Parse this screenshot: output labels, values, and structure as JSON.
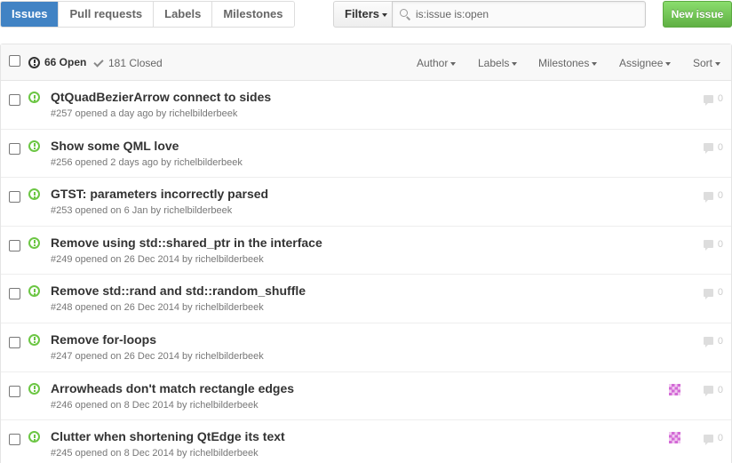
{
  "subnav": {
    "items": [
      {
        "label": "Issues",
        "selected": true
      },
      {
        "label": "Pull requests"
      },
      {
        "label": "Labels"
      },
      {
        "label": "Milestones"
      }
    ]
  },
  "filters": {
    "label": "Filters"
  },
  "search": {
    "value": "is:issue is:open"
  },
  "new_issue": {
    "label": "New issue"
  },
  "header": {
    "open_label": "66 Open",
    "closed_label": "181 Closed",
    "menus": [
      "Author",
      "Labels",
      "Milestones",
      "Assignee",
      "Sort"
    ]
  },
  "issues": [
    {
      "title": "QtQuadBezierArrow connect to sides",
      "meta": "#257 opened a day ago by",
      "author": "richelbilderbeek",
      "comments": "0",
      "has_avatar": false
    },
    {
      "title": "Show some QML love",
      "meta": "#256 opened 2 days ago by",
      "author": "richelbilderbeek",
      "comments": "0",
      "has_avatar": false
    },
    {
      "title": "GTST: parameters incorrectly parsed",
      "meta": "#253 opened on 6 Jan by",
      "author": "richelbilderbeek",
      "comments": "0",
      "has_avatar": false
    },
    {
      "title": "Remove using std::shared_ptr in the interface",
      "meta": "#249 opened on 26 Dec 2014 by",
      "author": "richelbilderbeek",
      "comments": "0",
      "has_avatar": false
    },
    {
      "title": "Remove std::rand and std::random_shuffle",
      "meta": "#248 opened on 26 Dec 2014 by",
      "author": "richelbilderbeek",
      "comments": "0",
      "has_avatar": false
    },
    {
      "title": "Remove for-loops",
      "meta": "#247 opened on 26 Dec 2014 by",
      "author": "richelbilderbeek",
      "comments": "0",
      "has_avatar": false
    },
    {
      "title": "Arrowheads don't match rectangle edges",
      "meta": "#246 opened on 8 Dec 2014 by",
      "author": "richelbilderbeek",
      "comments": "0",
      "has_avatar": true
    },
    {
      "title": "Clutter when shortening QtEdge its text",
      "meta": "#245 opened on 8 Dec 2014 by",
      "author": "richelbilderbeek",
      "comments": "0",
      "has_avatar": true
    }
  ],
  "colors": {
    "selected_tab": "#4183c4",
    "new_issue_green": "#6cc644",
    "open_icon_green": "#6cc644",
    "avatar_pink": "#d36ad6"
  }
}
